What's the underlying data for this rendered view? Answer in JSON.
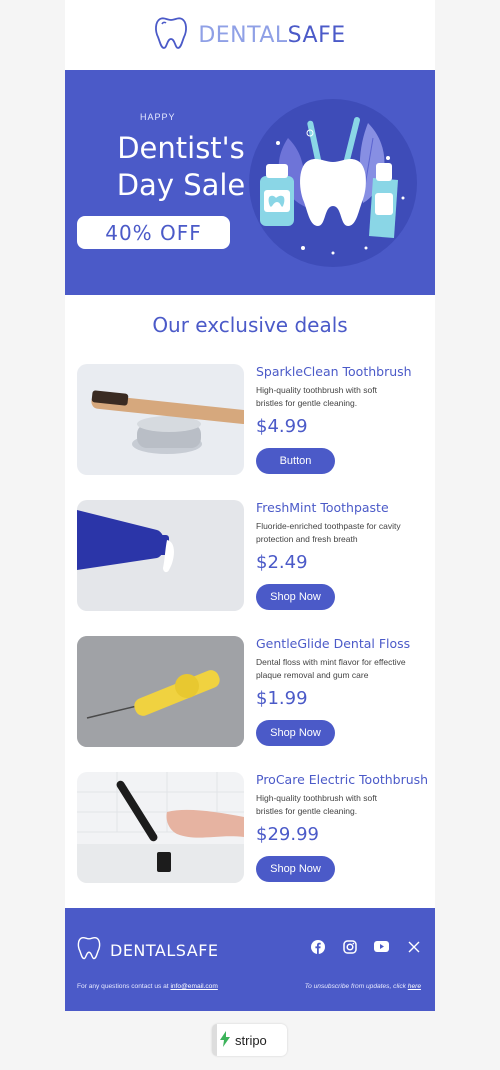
{
  "header": {
    "brand_part1": "DENTAL",
    "brand_part2": "SAFE"
  },
  "hero": {
    "happy": "HAPPY",
    "title_line1": "Dentist's",
    "title_line2": "Day Sale",
    "offer": "40% OFF"
  },
  "deals": {
    "heading": "Our exclusive deals",
    "products": [
      {
        "name": "SparkleClean Toothbrush",
        "desc": "High-quality toothbrush with soft bristles for gentle cleaning.",
        "price": "$4.99",
        "button": "Button"
      },
      {
        "name": "FreshMint Toothpaste",
        "desc": "Fluoride-enriched toothpaste for cavity protection and fresh breath",
        "price": "$2.49",
        "button": "Shop Now"
      },
      {
        "name": "GentleGlide Dental Floss",
        "desc": "Dental floss with mint flavor for effective plaque removal and gum care",
        "price": "$1.99",
        "button": "Shop Now"
      },
      {
        "name": "ProCare Electric Toothbrush",
        "desc": "High-quality toothbrush with soft bristles for gentle cleaning.",
        "price": "$29.99",
        "button": "Shop Now"
      }
    ]
  },
  "footer": {
    "brand": "DENTALSAFE",
    "contact_text": "For any questions contact us at ",
    "contact_email": "info@email.com",
    "unsub_text": "To unsubscribe from  updates, click ",
    "unsub_link": "here",
    "social": [
      "facebook-icon",
      "instagram-icon",
      "youtube-icon",
      "x-icon"
    ]
  },
  "badge": {
    "label": "stripo"
  },
  "colors": {
    "primary": "#4b5ac8",
    "light_primary": "#8fa0e6",
    "background": "#f5f5f5"
  }
}
